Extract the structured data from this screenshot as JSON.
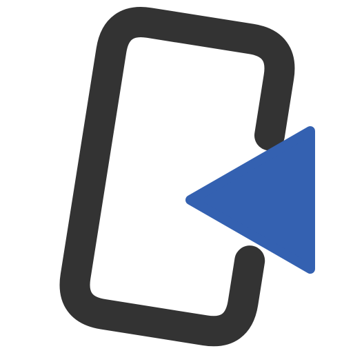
{
  "icon": {
    "name": "exit-arrow-icon",
    "colors": {
      "frame": "#333333",
      "arrow": "#3461b1",
      "background": "#ffffff"
    }
  }
}
